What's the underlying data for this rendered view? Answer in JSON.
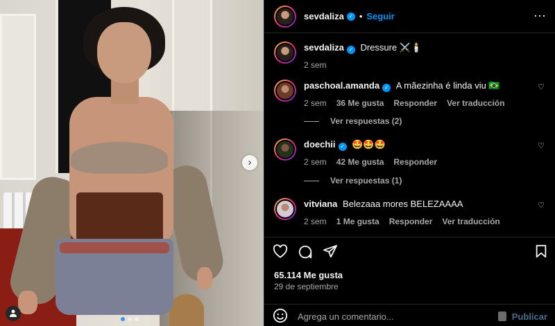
{
  "post_author": {
    "username": "sevdaliza",
    "follow_label": "Seguir",
    "separator": "•",
    "more_label": "⋯"
  },
  "caption": {
    "username": "sevdaliza",
    "text": "Dressure ⚔️🕯️",
    "time": "2 sem"
  },
  "comments": [
    {
      "username": "paschoal.amanda",
      "verified": true,
      "text": "A mãezinha é linda viu 🇧🇷",
      "time": "2 sem",
      "likes": "36 Me gusta",
      "reply_label": "Responder",
      "translate_label": "Ver traducción",
      "view_replies": "Ver respuestas (2)"
    },
    {
      "username": "doechii",
      "verified": true,
      "text": "🤩🤩🤩",
      "time": "2 sem",
      "likes": "42 Me gusta",
      "reply_label": "Responder",
      "view_replies": "Ver respuestas (1)"
    },
    {
      "username": "vitviana",
      "verified": false,
      "text": "Belezaaa mores BELEZAAAA",
      "time": "2 sem",
      "likes": "1 Me gusta",
      "reply_label": "Responder",
      "translate_label": "Ver traducción"
    }
  ],
  "stats": {
    "likes": "65.114 Me gusta",
    "date": "29 de septiembre"
  },
  "composer": {
    "placeholder": "Agrega un comentario...",
    "publish_label": "Publicar"
  },
  "carousel": {
    "next_label": "›",
    "total_slides": 3,
    "current_slide": 1
  },
  "colors": {
    "accent": "#0095f6",
    "background": "#000000",
    "text": "#f5f5f5",
    "muted": "#a8a8a8",
    "divider": "#262626"
  }
}
